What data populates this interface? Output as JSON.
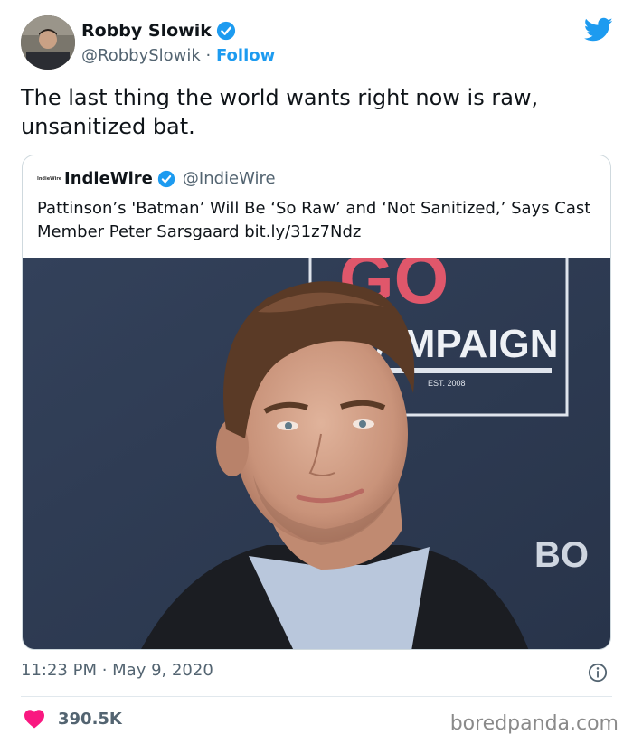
{
  "author": {
    "display_name": "Robby Slowik",
    "handle": "@RobbySlowik",
    "separator": " · ",
    "follow_label": "Follow"
  },
  "tweet": {
    "text": "The last thing the world wants right now is raw, unsanitized bat."
  },
  "quoted_tweet": {
    "logo_text": "IndieWire",
    "display_name": "IndieWire",
    "handle": "@IndieWire",
    "text": "Pattinson’s 'Batman’ Will Be ‘So Raw’ and ‘Not Sanitized,’ Says Cast Member Peter Sarsgaard bit.ly/31z7Ndz",
    "image": {
      "backdrop_letters": "GO",
      "backdrop_word": "AMPAIGN",
      "backdrop_est": "EST. 2008",
      "backdrop_side": "BO"
    }
  },
  "meta": {
    "timestamp": "11:23 PM · May 9, 2020",
    "likes": "390.5K"
  },
  "watermark": "boredpanda.com",
  "colors": {
    "accent": "#1d9bf0",
    "heart": "#f91880",
    "text": "#0f1419",
    "secondary": "#536471"
  },
  "icons": {
    "verified": "verified-badge-icon",
    "brand": "twitter-bird-icon",
    "info": "info-icon",
    "like": "heart-icon"
  }
}
